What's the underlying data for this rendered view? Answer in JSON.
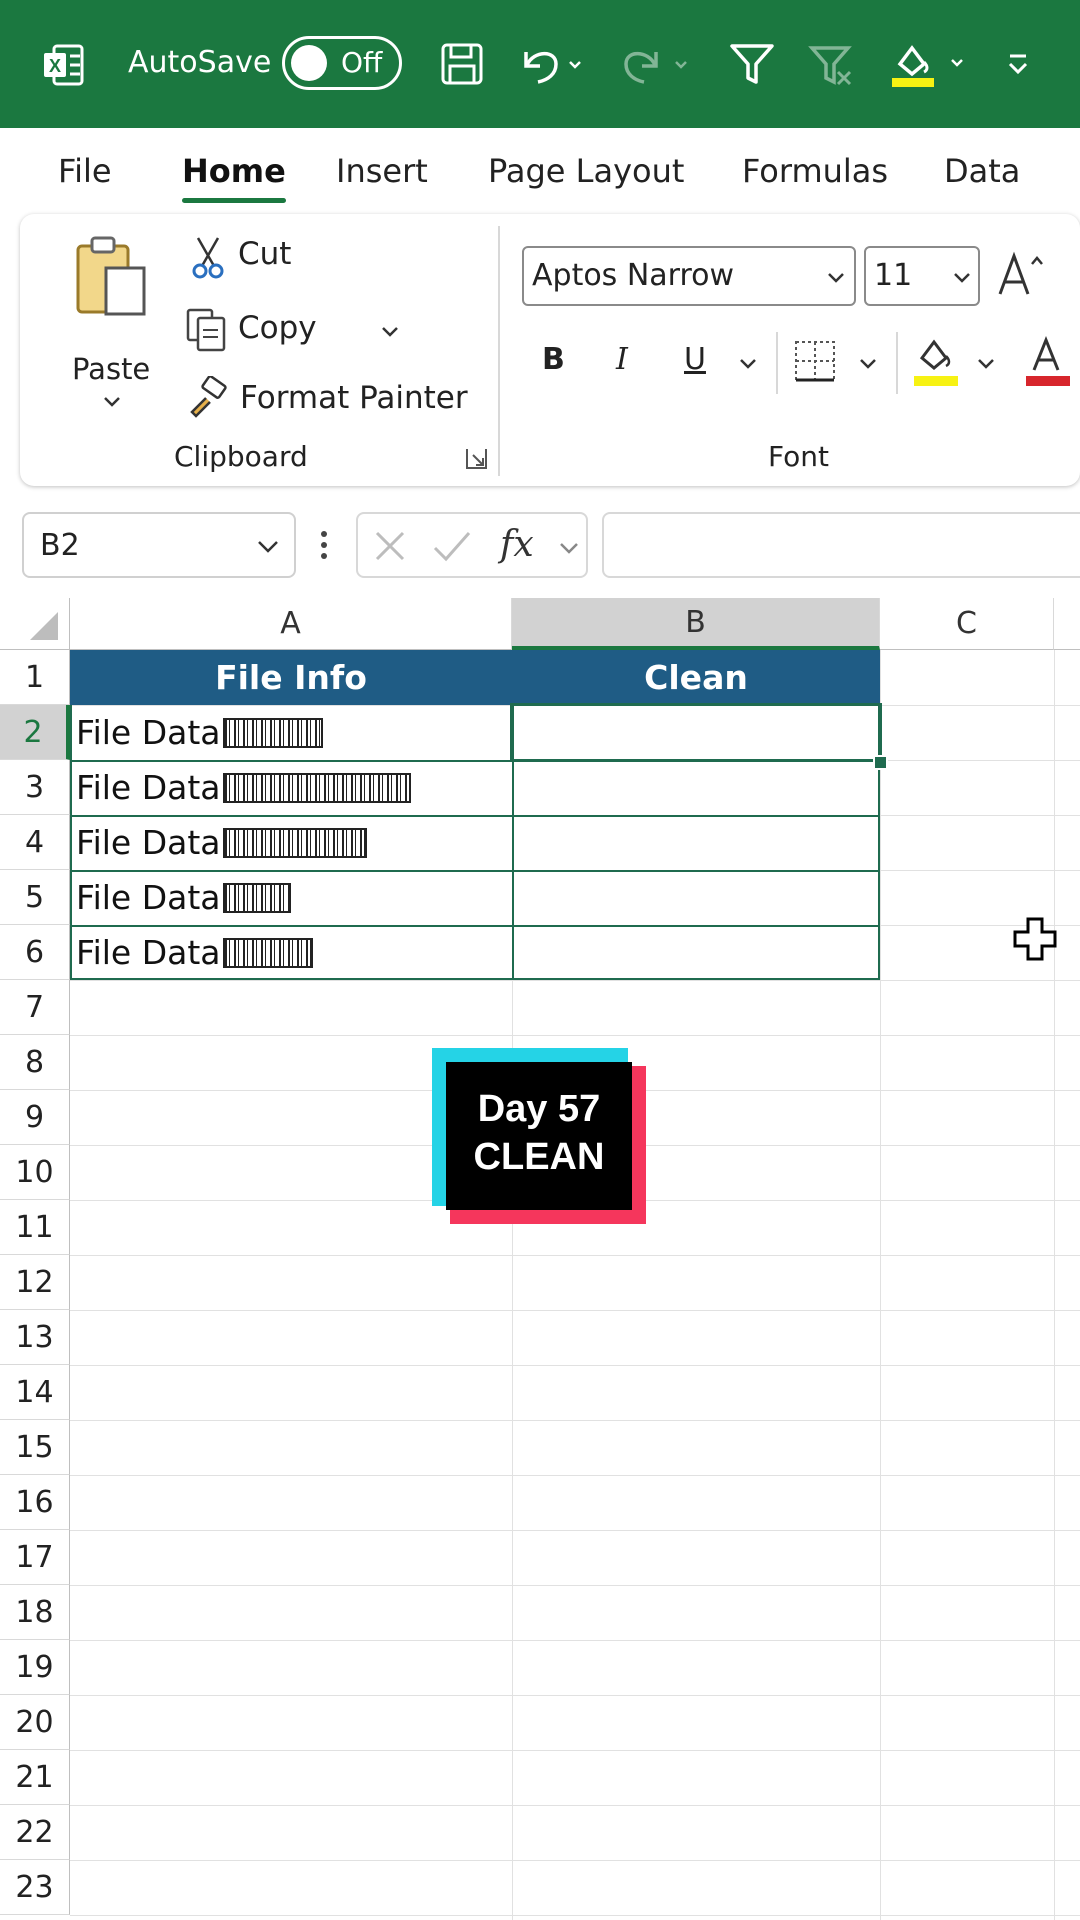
{
  "titlebar": {
    "autosave_label": "AutoSave",
    "toggle_label": "Off",
    "bg_color": "#1b7840"
  },
  "tabs": [
    "File",
    "Home",
    "Insert",
    "Page Layout",
    "Formulas",
    "Data"
  ],
  "ribbon": {
    "paste_label": "Paste",
    "cut_label": "Cut",
    "copy_label": "Copy",
    "format_painter_label": "Format Painter",
    "clipboard_group": "Clipboard",
    "font_name": "Aptos Narrow",
    "font_size": "11",
    "bold": "B",
    "italic": "I",
    "underline": "U",
    "font_group": "Font"
  },
  "formula_bar": {
    "name_box": "B2",
    "fx": "fx",
    "value": ""
  },
  "sheet": {
    "columns": [
      "A",
      "B",
      "C"
    ],
    "rows": [
      "1",
      "2",
      "3",
      "4",
      "5",
      "6",
      "7",
      "8",
      "9",
      "10",
      "11",
      "12",
      "13",
      "14",
      "15",
      "16",
      "17",
      "18",
      "19",
      "20",
      "21",
      "22",
      "23"
    ],
    "header_row": [
      "File Info",
      "Clean"
    ],
    "data": [
      "File Data",
      "File Data",
      "File Data",
      "File Data",
      "File Data"
    ],
    "header_color": "#1f5c85",
    "active_cell": "B2"
  },
  "overlay": {
    "line1": "Day 57",
    "line2": "CLEAN"
  }
}
